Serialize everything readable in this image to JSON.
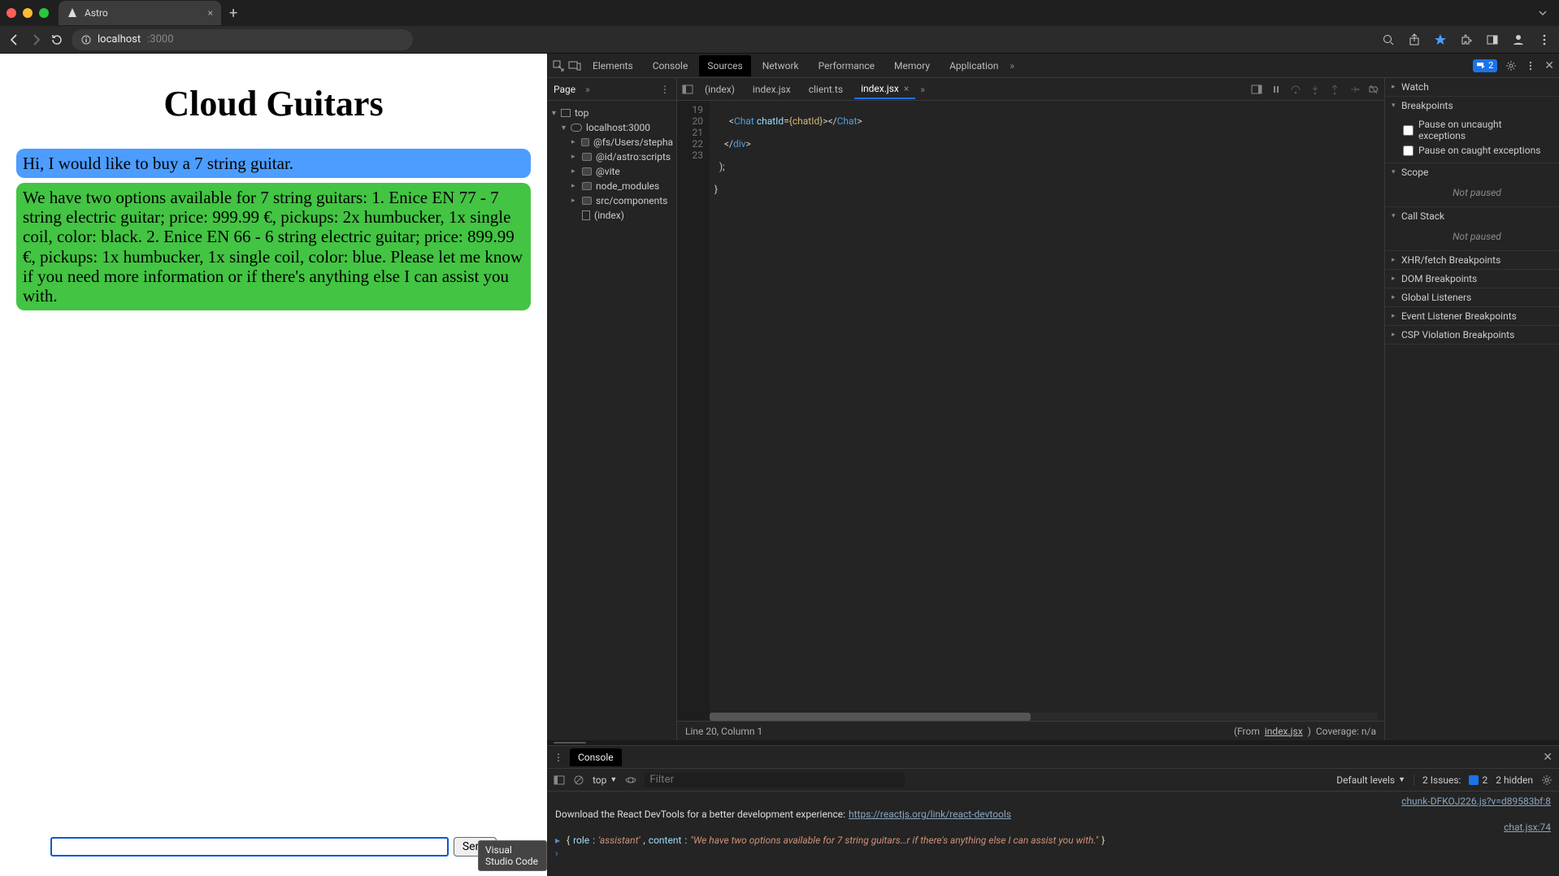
{
  "browser": {
    "tab_title": "Astro",
    "url_host": "localhost",
    "url_port": ":3000"
  },
  "page": {
    "title": "Cloud Guitars",
    "messages": [
      {
        "role": "user",
        "text": "Hi, I would like to buy a 7 string guitar."
      },
      {
        "role": "assistant",
        "text": "We have two options available for 7 string guitars: 1. Enice EN 77 - 7 string electric guitar; price: 999.99 €, pickups: 2x humbucker, 1x single coil, color: black. 2. Enice EN 66 - 6 string electric guitar; price: 899.99 €, pickups: 1x humbucker, 1x single coil, color: blue. Please let me know if you need more information or if there's anything else I can assist you with."
      }
    ],
    "send_label": "Send",
    "tooltip": "Visual Studio Code"
  },
  "devtools": {
    "tabs": [
      "Elements",
      "Console",
      "Sources",
      "Network",
      "Performance",
      "Memory",
      "Application"
    ],
    "active_tab": "Sources",
    "warning_count": "2",
    "sources": {
      "left_tab": "Page",
      "tree": {
        "top": "top",
        "host": "localhost:3000",
        "folders": [
          "@fs/Users/stepha",
          "@id/astro:scripts",
          "@vite",
          "node_modules",
          "src/components"
        ],
        "file": "(index)"
      },
      "open_files": [
        "(index)",
        "index.jsx",
        "client.ts",
        "index.jsx"
      ],
      "active_file": "index.jsx",
      "line_numbers": [
        "19",
        "20",
        "21",
        "22",
        "23"
      ],
      "code_lines": {
        "l19": {
          "open_tag": "Chat",
          "attr": "chatId",
          "expr": "{chatId}",
          "close_tag": "Chat"
        },
        "l20_close": "div",
        "l21": ");",
        "l22": "}"
      },
      "status": {
        "pos": "Line 20, Column 1",
        "from_label": "(From ",
        "from_file": "index.jsx",
        "from_close": ")",
        "coverage": "Coverage: n/a"
      }
    },
    "right": {
      "watch": "Watch",
      "breakpoints": "Breakpoints",
      "pause_uncaught": "Pause on uncaught exceptions",
      "pause_caught": "Pause on caught exceptions",
      "scope": "Scope",
      "not_paused": "Not paused",
      "callstack": "Call Stack",
      "xhr": "XHR/fetch Breakpoints",
      "dom": "DOM Breakpoints",
      "global": "Global Listeners",
      "event": "Event Listener Breakpoints",
      "csp": "CSP Violation Breakpoints"
    },
    "console": {
      "tab": "Console",
      "context": "top",
      "filter_placeholder": "Filter",
      "levels": "Default levels",
      "issues_label": "2 Issues:",
      "issues_count": "2",
      "hidden": "2 hidden",
      "msg_source1": "chunk-DFKOJ226.js?v=d89583bf:8",
      "msg1_a": "Download the React DevTools for a better development experience: ",
      "msg1_link": "https://reactjs.org/link/react-devtools",
      "msg_source2": "chat.jsx:74",
      "obj_role_key": "role",
      "obj_role_val": "'assistant'",
      "obj_content_key": "content",
      "obj_content_val": "\"We have two options available for 7 string guitars…r if there's anything else I can assist you with.\""
    }
  }
}
